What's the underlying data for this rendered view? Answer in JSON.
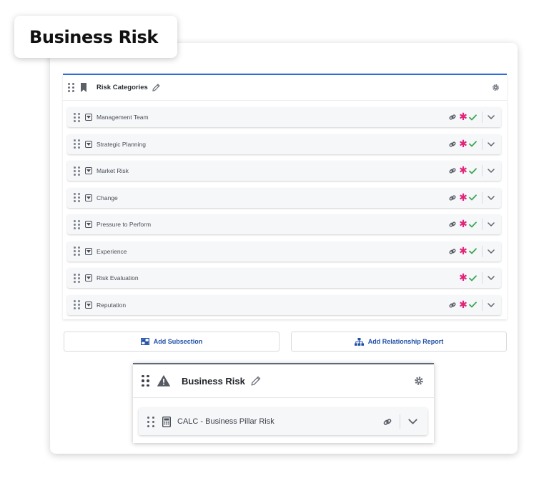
{
  "page_title": "Business Risk",
  "section": {
    "title": "Risk Categories",
    "rows": [
      {
        "label": "Management Team",
        "has_link": true
      },
      {
        "label": "Strategic Planning",
        "has_link": true
      },
      {
        "label": "Market Risk",
        "has_link": true
      },
      {
        "label": "Change",
        "has_link": true
      },
      {
        "label": "Pressure to Perform",
        "has_link": true
      },
      {
        "label": "Experience",
        "has_link": true
      },
      {
        "label": "Risk Evaluation",
        "has_link": false
      },
      {
        "label": "Reputation",
        "has_link": true
      }
    ]
  },
  "actions": {
    "add_subsection": "Add Subsection",
    "add_relationship_report": "Add Relationship Report"
  },
  "business_risk_card": {
    "title": "Business Risk",
    "row_label": "CALC - Business Pillar Risk"
  },
  "icons": {
    "required": "asterisk-icon",
    "complete": "check-icon",
    "linked": "link-icon"
  },
  "colors": {
    "accent_blue": "#2d6bd6",
    "button_text": "#1f4fa6",
    "required_pink": "#e0267a",
    "check_green": "#3aa657"
  }
}
